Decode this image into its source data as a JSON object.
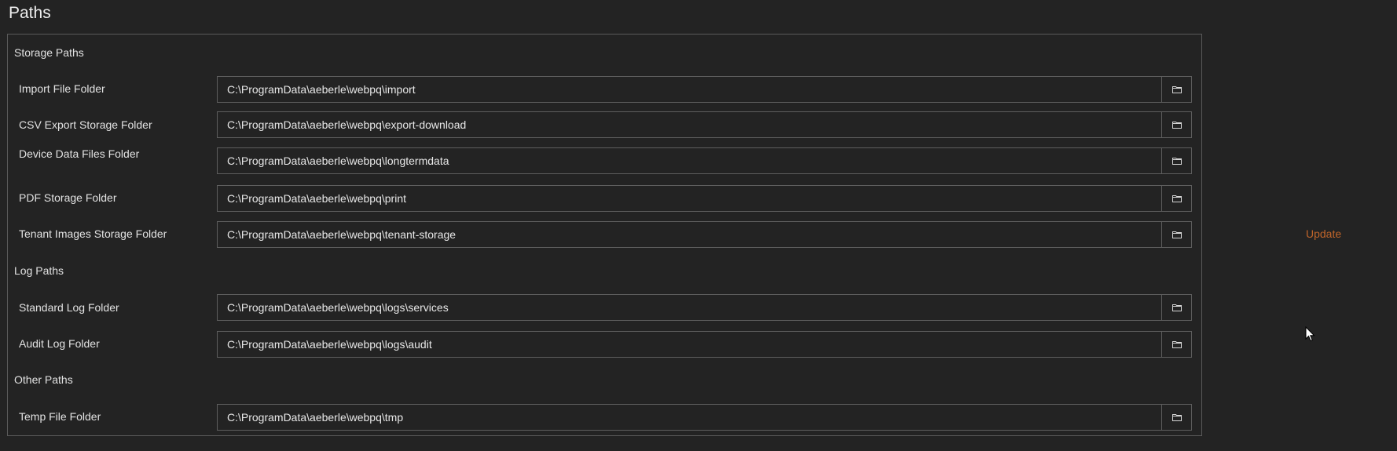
{
  "page": {
    "title": "Paths"
  },
  "sections": {
    "storage": {
      "title": "Storage Paths"
    },
    "log": {
      "title": "Log Paths"
    },
    "other": {
      "title": "Other Paths"
    }
  },
  "fields": {
    "import_folder": {
      "label": "Import File Folder",
      "value": "C:\\ProgramData\\aeberle\\webpq\\import"
    },
    "csv_export_folder": {
      "label": "CSV Export Storage Folder",
      "value": "C:\\ProgramData\\aeberle\\webpq\\export-download"
    },
    "device_data_folder": {
      "label": "Device Data Files Folder",
      "value": "C:\\ProgramData\\aeberle\\webpq\\longtermdata"
    },
    "pdf_storage_folder": {
      "label": "PDF Storage Folder",
      "value": "C:\\ProgramData\\aeberle\\webpq\\print"
    },
    "tenant_images_folder": {
      "label": "Tenant Images Storage Folder",
      "value": "C:\\ProgramData\\aeberle\\webpq\\tenant-storage"
    },
    "standard_log_folder": {
      "label": "Standard Log Folder",
      "value": "C:\\ProgramData\\aeberle\\webpq\\logs\\services"
    },
    "audit_log_folder": {
      "label": "Audit Log Folder",
      "value": "C:\\ProgramData\\aeberle\\webpq\\logs\\audit"
    },
    "temp_file_folder": {
      "label": "Temp File Folder",
      "value": "C:\\ProgramData\\aeberle\\webpq\\tmp"
    }
  },
  "actions": {
    "update_label": "Update"
  },
  "icons": {
    "browse": "folder-icon",
    "cursor": "mouse-pointer-icon"
  },
  "colors": {
    "background": "#232323",
    "border": "#5e5e5e",
    "text": "#e2e2e2",
    "accent_link": "#c0652a"
  }
}
